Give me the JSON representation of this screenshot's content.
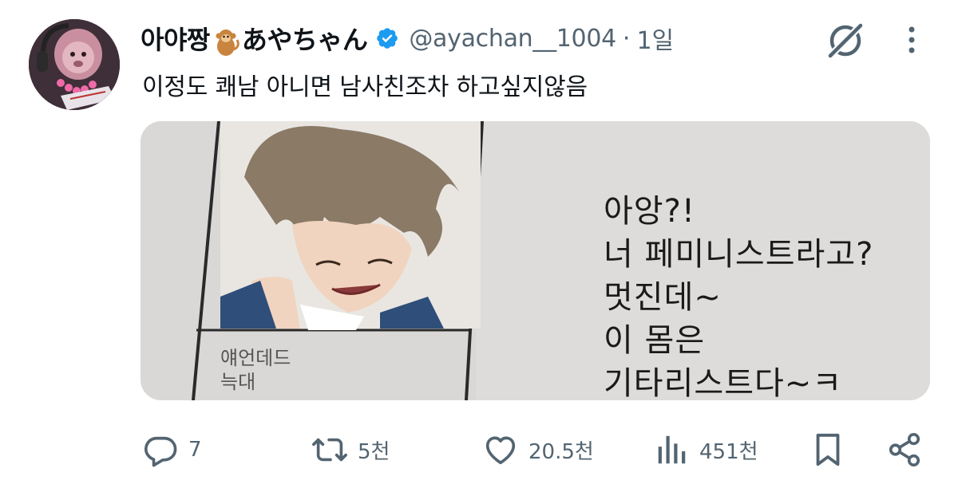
{
  "author": {
    "display_name_part1": "아야짱",
    "display_name_emoji": "monkey-emoji",
    "display_name_part2": "あやちゃん",
    "verified": true,
    "handle": "@ayachan__1004",
    "separator": "·",
    "time": "1일"
  },
  "tweet": {
    "text": "이정도 쾌남 아니면 남사친조차 하고싶지않음"
  },
  "media": {
    "panel_caption_lines": [
      "얘언데드",
      "늑대"
    ],
    "speech_lines": [
      "아앙?!",
      "너 페미니스트라고?",
      "멋진데~",
      "이 몸은",
      "기타리스트다~ㅋ"
    ]
  },
  "actions": {
    "reply_count": "7",
    "retweet_count": "5천",
    "like_count": "20.5천",
    "views_count": "451천"
  },
  "icons": {
    "grok": "grok-icon",
    "more": "more-icon",
    "reply": "reply-icon",
    "retweet": "retweet-icon",
    "like": "heart-icon",
    "views": "views-icon",
    "bookmark": "bookmark-icon",
    "share": "share-icon"
  },
  "colors": {
    "text_primary": "#0f1419",
    "text_secondary": "#536471",
    "verified_blue": "#1d9bf0"
  }
}
